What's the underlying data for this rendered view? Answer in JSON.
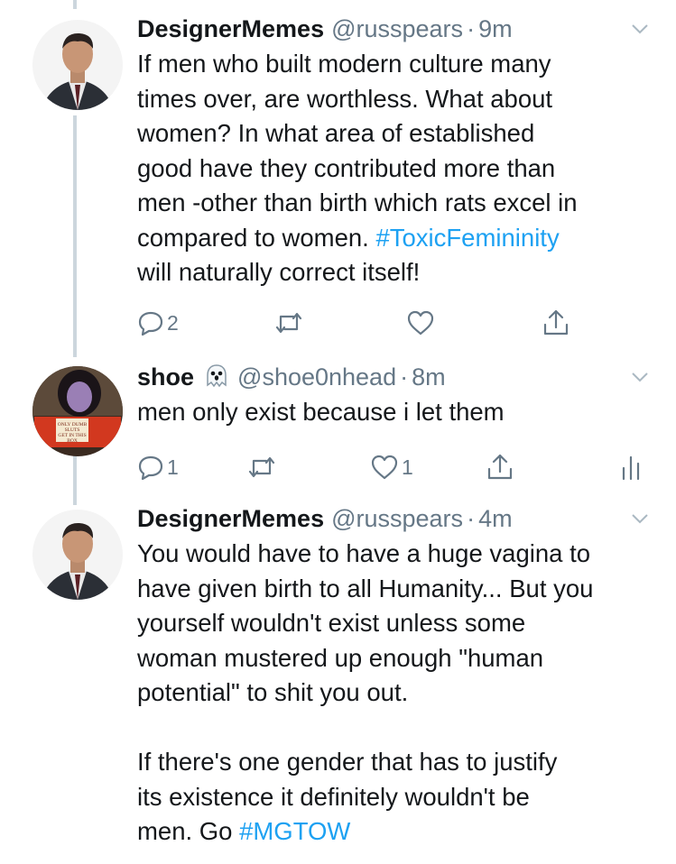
{
  "tweets": [
    {
      "name": "DesignerMemes",
      "handle": "@russpears",
      "dot": "·",
      "time": "9m",
      "text_lines": [
        "If men who built modern culture many",
        "times over, are worthless. What about",
        "women? In what area of established",
        "good have they contributed more than",
        "men -other than birth which rats excel in"
      ],
      "text_pre_hashtag": "compared to women. ",
      "hashtag": "#ToxicFemininity",
      "text_post": "will naturally correct itself!",
      "reply_count": "2",
      "retweet_count": "",
      "like_count": "",
      "avatar_icon": "profile-photo-man-in-suit"
    },
    {
      "name": "shoe",
      "emoji_icon": "ghost-icon",
      "handle": "@shoe0nhead",
      "dot": "·",
      "time": "8m",
      "text": "men only exist because i let them",
      "reply_count": "1",
      "retweet_count": "",
      "like_count": "1",
      "box_text": "ONLY DUMB SLUTS GET IN THIS BOX",
      "avatar_icon": "profile-photo-woman-with-box"
    },
    {
      "name": "DesignerMemes",
      "handle": "@russpears",
      "dot": "·",
      "time": "4m",
      "para1_lines": [
        "You would have to have a huge vagina to",
        "have given birth to all Humanity... But you",
        "yourself wouldn't exist unless some",
        "woman mustered up enough \"human",
        "potential\" to shit you out."
      ],
      "para2_lines": [
        "If there's one gender that has to justify",
        "its existence it definitely wouldn't be"
      ],
      "para2_last_pre": "men. Go ",
      "hashtag": "#MGTOW",
      "avatar_icon": "profile-photo-man-in-suit"
    }
  ],
  "colors": {
    "text": "#14171a",
    "secondary": "#657786",
    "link": "#1da1f2",
    "thread_line": "#ccd6dd"
  }
}
